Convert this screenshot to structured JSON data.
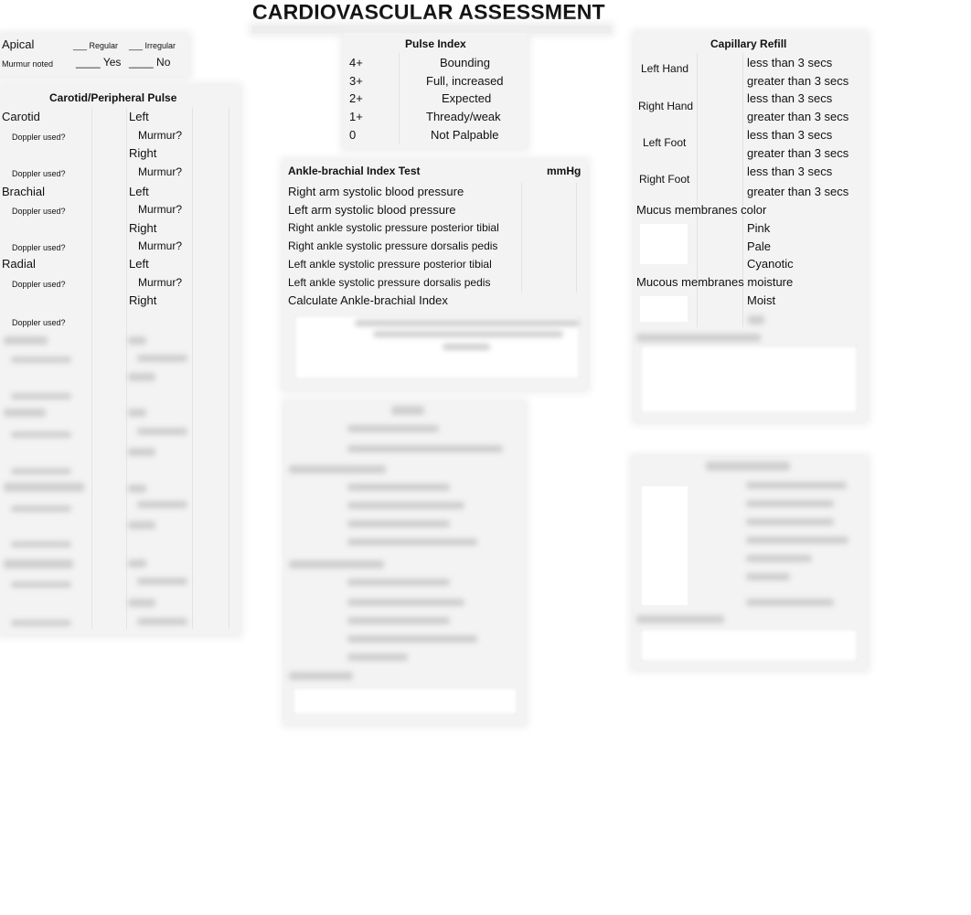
{
  "title": "CARDIOVASCULAR ASSESSMENT",
  "apical": {
    "label": "Apical",
    "regular": "___ Regular",
    "irregular": "___ Irregular",
    "murmur_label": "Murmur noted",
    "yes": "____ Yes",
    "no": "____ No"
  },
  "carotid_peripheral": {
    "heading": "Carotid/Peripheral Pulse",
    "sites": [
      {
        "name": "Carotid",
        "left": "Left",
        "right": "Right",
        "murmur": "Murmur?",
        "doppler": "Doppler used?"
      },
      {
        "name": "Brachial",
        "left": "Left",
        "right": "Right",
        "murmur": "Murmur?",
        "doppler": "Doppler used?"
      },
      {
        "name": "Radial",
        "left": "Left",
        "right": "Right",
        "murmur": "Murmur?",
        "doppler": "Doppler used?"
      }
    ]
  },
  "pulse_index": {
    "heading": "Pulse Index",
    "rows": [
      {
        "grade": "4+",
        "desc": "Bounding"
      },
      {
        "grade": "3+",
        "desc": "Full, increased"
      },
      {
        "grade": "2+",
        "desc": "Expected"
      },
      {
        "grade": "1+",
        "desc": "Thready/weak"
      },
      {
        "grade": "0",
        "desc": "Not Palpable"
      }
    ]
  },
  "abi": {
    "heading": "Ankle-brachial Index Test",
    "unit": "mmHg",
    "rows": [
      "Right arm systolic blood pressure",
      "Left arm systolic blood pressure",
      "Right ankle systolic pressure posterior tibial",
      "Right ankle systolic pressure dorsalis pedis",
      "Left ankle systolic pressure posterior tibial",
      "Left ankle systolic pressure dorsalis pedis",
      "Calculate Ankle-brachial Index"
    ]
  },
  "capillary_refill": {
    "heading": "Capillary Refill",
    "sites": [
      {
        "name": "Left Hand",
        "less": "less than 3 secs",
        "greater": "greater than 3 secs"
      },
      {
        "name": "Right Hand",
        "less": "less than 3 secs",
        "greater": "greater than 3 secs"
      },
      {
        "name": "Left Foot",
        "less": "less than 3 secs",
        "greater": "greater than 3 secs"
      },
      {
        "name": "Right Foot",
        "less": "less than 3 secs",
        "greater": "greater than 3 secs"
      }
    ]
  },
  "mucus": {
    "color_label": "Mucus membranes color",
    "colors": [
      "Pink",
      "Pale",
      "Cyanotic"
    ],
    "moisture_label": "Mucous membranes moisture",
    "moisture": [
      "Moist"
    ]
  }
}
